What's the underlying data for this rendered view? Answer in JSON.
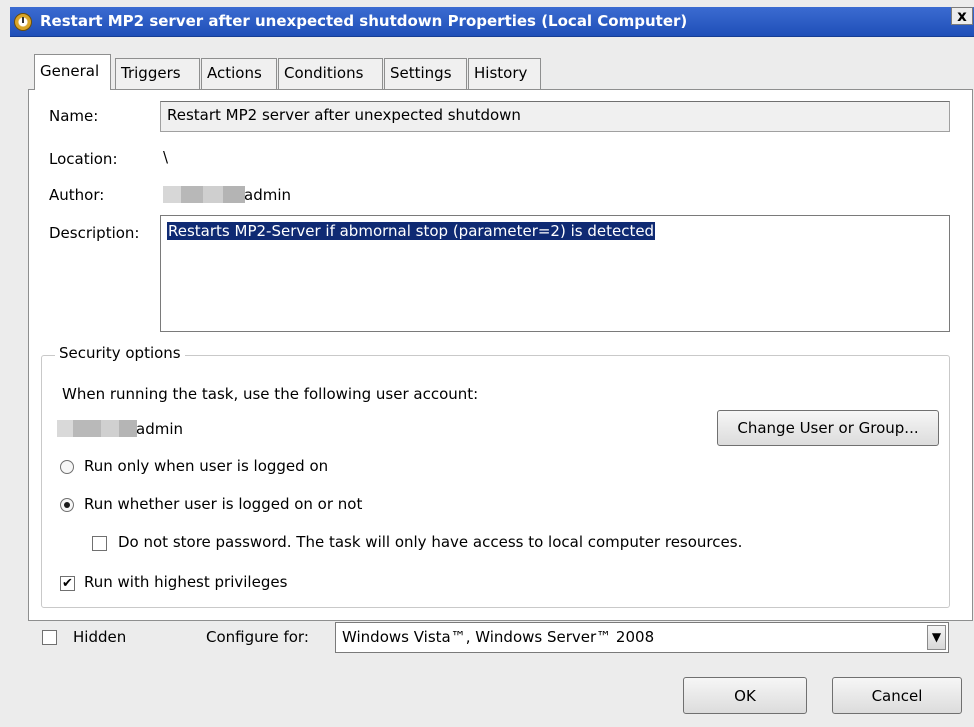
{
  "window": {
    "title": "Restart MP2 server after unexpected shutdown Properties (Local Computer)",
    "close_label": "x"
  },
  "tabs": [
    {
      "label": "General",
      "active": true
    },
    {
      "label": "Triggers"
    },
    {
      "label": "Actions"
    },
    {
      "label": "Conditions"
    },
    {
      "label": "Settings"
    },
    {
      "label": "History"
    }
  ],
  "general": {
    "name_label": "Name:",
    "name_value": "Restart MP2 server after unexpected shutdown",
    "location_label": "Location:",
    "location_value": "\\",
    "author_label": "Author:",
    "author_value": "admin",
    "description_label": "Description:",
    "description_value": "Restarts MP2-Server if abmornal stop (parameter=2) is detected"
  },
  "security": {
    "title": "Security options",
    "account_prompt": "When running the task, use the following user account:",
    "account_value": "admin",
    "change_button": "Change User or Group...",
    "radio_logged_on": "Run only when user is logged on",
    "radio_logged_on_checked": false,
    "radio_whether": "Run whether user is logged on or not",
    "radio_whether_checked": true,
    "no_store_password": "Do not store password.  The task will only have access to local computer resources.",
    "no_store_password_checked": false,
    "highest_privileges": "Run with highest privileges",
    "highest_privileges_checked": true
  },
  "footer": {
    "hidden_label": "Hidden",
    "hidden_checked": false,
    "configure_label": "Configure for:",
    "configure_value": "Windows Vista™, Windows Server™ 2008",
    "ok_button": "OK",
    "cancel_button": "Cancel"
  },
  "icons": {
    "app": "task-scheduler-clock-icon",
    "dropdown": "chevron-down-icon",
    "check": "✔"
  }
}
